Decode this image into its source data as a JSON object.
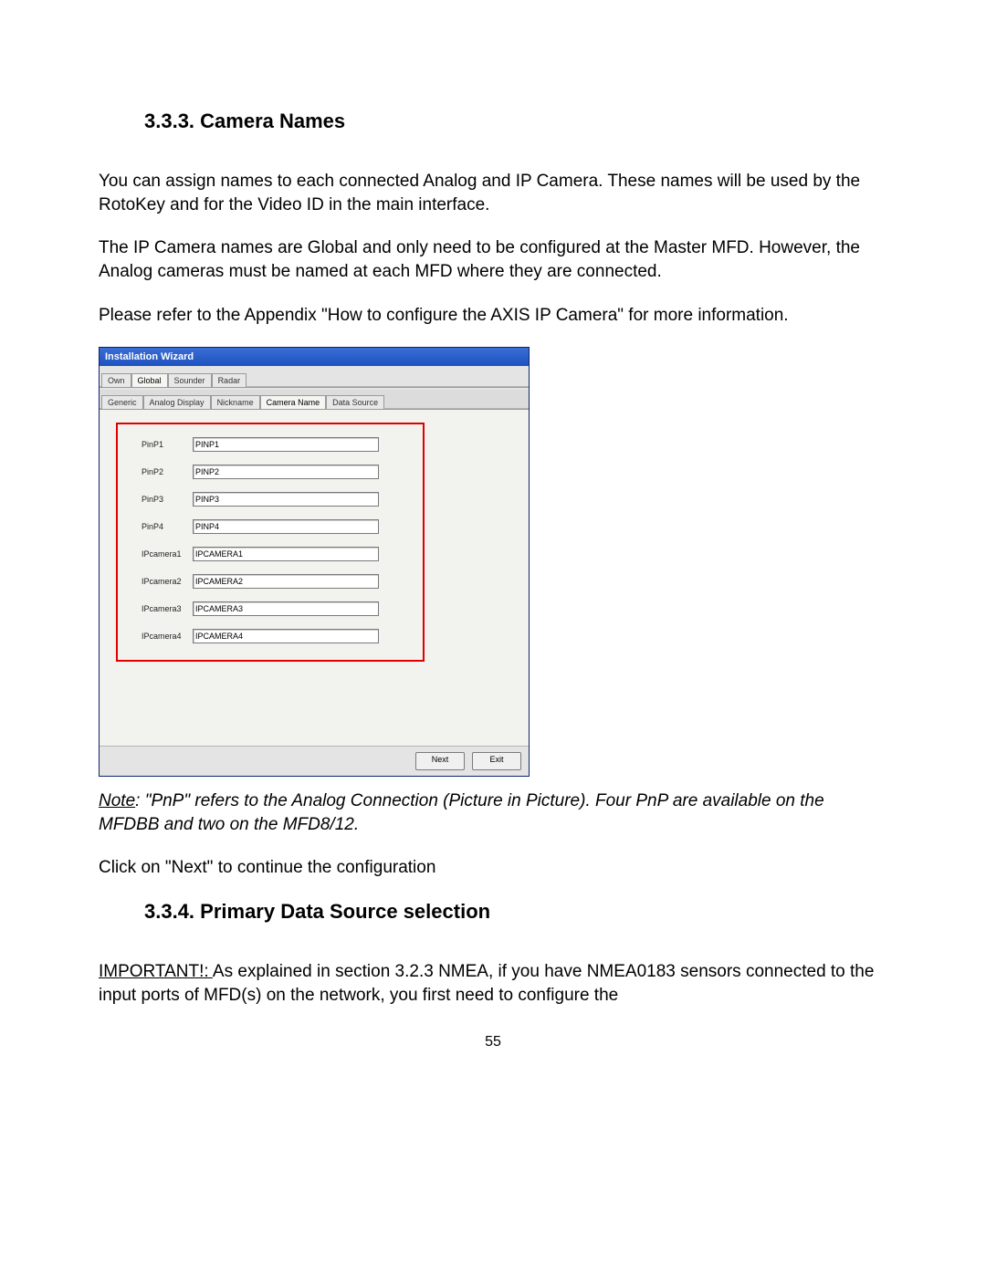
{
  "section_333_title": "3.3.3. Camera Names",
  "para_1": "You can assign names to each connected Analog and IP Camera. These names will be used by the RotoKey and for the Video ID in the main interface.",
  "para_2": "The IP Camera names are Global and only need to be configured at the Master MFD. However, the Analog cameras must be named at each MFD where they are connected.",
  "para_3": "Please refer to the Appendix \"How to configure the AXIS IP Camera\" for more information.",
  "wizard": {
    "title": "Installation Wizard",
    "outer_tabs": [
      "Own",
      "Global",
      "Sounder",
      "Radar"
    ],
    "outer_active": 1,
    "inner_tabs": [
      "Generic",
      "Analog Display",
      "Nickname",
      "Camera Name",
      "Data Source"
    ],
    "inner_active": 3,
    "fields": [
      {
        "label": "PinP1",
        "value": "PINP1"
      },
      {
        "label": "PinP2",
        "value": "PINP2"
      },
      {
        "label": "PinP3",
        "value": "PINP3"
      },
      {
        "label": "PinP4",
        "value": "PINP4"
      },
      {
        "label": "IPcamera1",
        "value": "IPCAMERA1"
      },
      {
        "label": "IPcamera2",
        "value": "IPCAMERA2"
      },
      {
        "label": "IPcamera3",
        "value": "IPCAMERA3"
      },
      {
        "label": "IPcamera4",
        "value": "IPCAMERA4"
      }
    ],
    "next_btn": "Next",
    "exit_btn": "Exit"
  },
  "note_label": "Note",
  "note_text": ": \"PnP\" refers to the Analog Connection (Picture in Picture). Four PnP are available on the MFDBB and two on the MFD8/12.",
  "click_next": "Click on \"Next\" to continue the configuration",
  "section_334_title": "3.3.4. Primary Data Source selection",
  "important_label": "IMPORTANT!: ",
  "important_text": "As explained in section 3.2.3 NMEA, if you have NMEA0183 sensors connected to the input ports of MFD(s) on the network, you first need to configure the",
  "page_number": "55"
}
